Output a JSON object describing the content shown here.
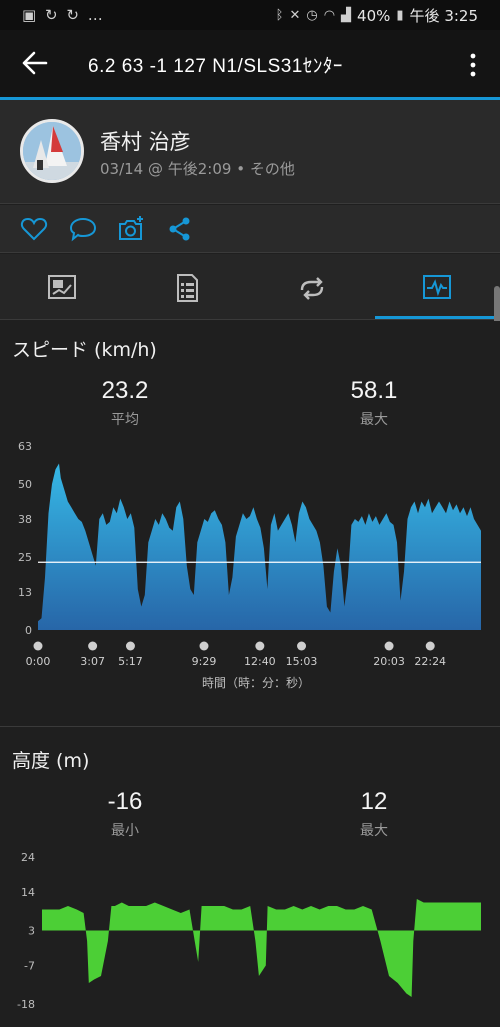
{
  "status_bar": {
    "left_icons": [
      "image-icon",
      "sync-icon",
      "sync-icon",
      "more-dots"
    ],
    "battery": "40%",
    "time": "午後 3:25"
  },
  "app_bar": {
    "title": "6.2  63  -1  127  N1/SLS31ｾﾝﾀｰ"
  },
  "profile": {
    "name": "香村 治彦",
    "subtitle": "03/14 @ 午後2:09 • その他"
  },
  "tabs": [
    "summary-icon",
    "details-icon",
    "laps-icon",
    "charts-icon"
  ],
  "active_tab": 3,
  "colors": {
    "accent": "#1697d6",
    "speed_fill": "#2a86c4",
    "speed_fill_top": "#34b4e4",
    "elevation_fill": "#4cd137",
    "background": "#1f1f1f"
  },
  "speed": {
    "title": "スピード (km/h)",
    "avg_value": "23.2",
    "avg_label": "平均",
    "max_value": "58.1",
    "max_label": "最大"
  },
  "elevation": {
    "title": "高度 (m)",
    "min_value": "-16",
    "min_label": "最小",
    "max_value": "12",
    "max_label": "最大"
  },
  "chart_data": [
    {
      "type": "area",
      "ylabel": "",
      "xlabel": "時間（時：分：秒）",
      "y_ticks": [
        "63",
        "50",
        "38",
        "25",
        "13",
        "0"
      ],
      "x_ticks": [
        "0:00",
        "3:07",
        "5:17",
        "9:29",
        "12:40",
        "15:03",
        "20:03",
        "22:24"
      ],
      "x_tick_minutes": [
        0,
        3.12,
        5.28,
        9.48,
        12.67,
        15.05,
        20.05,
        22.4
      ],
      "ylim": [
        0,
        63
      ],
      "xlim_minutes": [
        0,
        25.3
      ],
      "reference_line": 23.2,
      "x_minutes": [
        0,
        0.2,
        0.4,
        0.6,
        0.8,
        1.0,
        1.2,
        1.3,
        1.5,
        1.7,
        1.9,
        2.1,
        2.3,
        2.5,
        2.7,
        2.9,
        3.1,
        3.3,
        3.5,
        3.7,
        3.9,
        4.1,
        4.3,
        4.5,
        4.7,
        4.9,
        5.1,
        5.3,
        5.5,
        5.7,
        5.9,
        6.1,
        6.3,
        6.5,
        6.7,
        6.9,
        7.1,
        7.3,
        7.5,
        7.7,
        7.9,
        8.1,
        8.3,
        8.5,
        8.7,
        8.9,
        9.1,
        9.3,
        9.5,
        9.7,
        9.9,
        10.1,
        10.3,
        10.5,
        10.7,
        10.9,
        11.1,
        11.3,
        11.5,
        11.7,
        11.9,
        12.1,
        12.3,
        12.5,
        12.7,
        12.9,
        13.1,
        13.3,
        13.5,
        13.7,
        13.9,
        14.1,
        14.3,
        14.5,
        14.7,
        14.9,
        15.1,
        15.3,
        15.5,
        15.7,
        15.9,
        16.1,
        16.3,
        16.5,
        16.7,
        16.9,
        17.1,
        17.3,
        17.5,
        17.7,
        17.9,
        18.1,
        18.3,
        18.5,
        18.7,
        18.9,
        19.1,
        19.3,
        19.5,
        19.7,
        19.9,
        20.1,
        20.3,
        20.5,
        20.7,
        20.9,
        21.1,
        21.3,
        21.5,
        21.7,
        21.9,
        22.1,
        22.3,
        22.5,
        22.7,
        22.9,
        23.1,
        23.3,
        23.5,
        23.7,
        23.9,
        24.1,
        24.3,
        24.5,
        24.7,
        24.9,
        25.1,
        25.3
      ],
      "series": [
        {
          "values": [
            3,
            4,
            18,
            40,
            50,
            55,
            57,
            52,
            48,
            44,
            42,
            40,
            38,
            37,
            34,
            30,
            26,
            22,
            38,
            40,
            36,
            37,
            42,
            40,
            45,
            42,
            38,
            40,
            35,
            14,
            8,
            12,
            30,
            34,
            38,
            36,
            40,
            38,
            35,
            34,
            42,
            44,
            38,
            22,
            14,
            12,
            30,
            34,
            38,
            37,
            40,
            41,
            38,
            36,
            30,
            12,
            18,
            32,
            36,
            40,
            38,
            39,
            42,
            38,
            35,
            28,
            14,
            36,
            40,
            34,
            36,
            38,
            40,
            36,
            30,
            40,
            44,
            42,
            38,
            36,
            34,
            30,
            22,
            8,
            6,
            20,
            28,
            22,
            8,
            18,
            36,
            38,
            37,
            39,
            36,
            40,
            37,
            39,
            36,
            38,
            40,
            37,
            36,
            30,
            10,
            20,
            38,
            42,
            44,
            40,
            44,
            42,
            45,
            40,
            42,
            44,
            42,
            40,
            44,
            41,
            43,
            40,
            42,
            39,
            42,
            38,
            36,
            34
          ]
        }
      ]
    },
    {
      "type": "area",
      "ylabel": "",
      "y_ticks": [
        "24",
        "14",
        "3",
        "-7",
        "-18"
      ],
      "ylim": [
        -18,
        24
      ],
      "xlim_minutes": [
        0,
        25.3
      ],
      "x_minutes": [
        0,
        0.5,
        1.0,
        1.5,
        2.0,
        2.4,
        2.6,
        2.7,
        3.0,
        3.4,
        3.8,
        4.0,
        4.2,
        4.6,
        5.0,
        5.5,
        6.0,
        6.5,
        7.0,
        7.5,
        8.0,
        8.5,
        8.8,
        9.0,
        9.2,
        9.5,
        10.0,
        10.5,
        11.0,
        11.5,
        12.0,
        12.3,
        12.5,
        12.9,
        13.0,
        13.5,
        14.0,
        14.5,
        15.0,
        15.5,
        16.0,
        16.5,
        17.0,
        17.5,
        18.0,
        18.5,
        19.0,
        19.5,
        20.0,
        20.5,
        21.0,
        21.3,
        21.4,
        21.6,
        22.0,
        22.5,
        23.0,
        23.5,
        24.0,
        24.5,
        25.0,
        25.3
      ],
      "series": [
        {
          "values": [
            9,
            9,
            9,
            10,
            9,
            8,
            0,
            -12,
            -11,
            -10,
            0,
            10,
            10,
            11,
            10,
            10,
            10,
            11,
            10,
            9,
            8,
            9,
            0,
            -6,
            10,
            10,
            10,
            10,
            9,
            9,
            10,
            0,
            -10,
            -7,
            10,
            9,
            9,
            10,
            9,
            10,
            9,
            10,
            10,
            9,
            9,
            10,
            9,
            0,
            -10,
            -12,
            -15,
            -16,
            0,
            12,
            11,
            11,
            11,
            11,
            11,
            11,
            11,
            11
          ]
        }
      ]
    }
  ]
}
